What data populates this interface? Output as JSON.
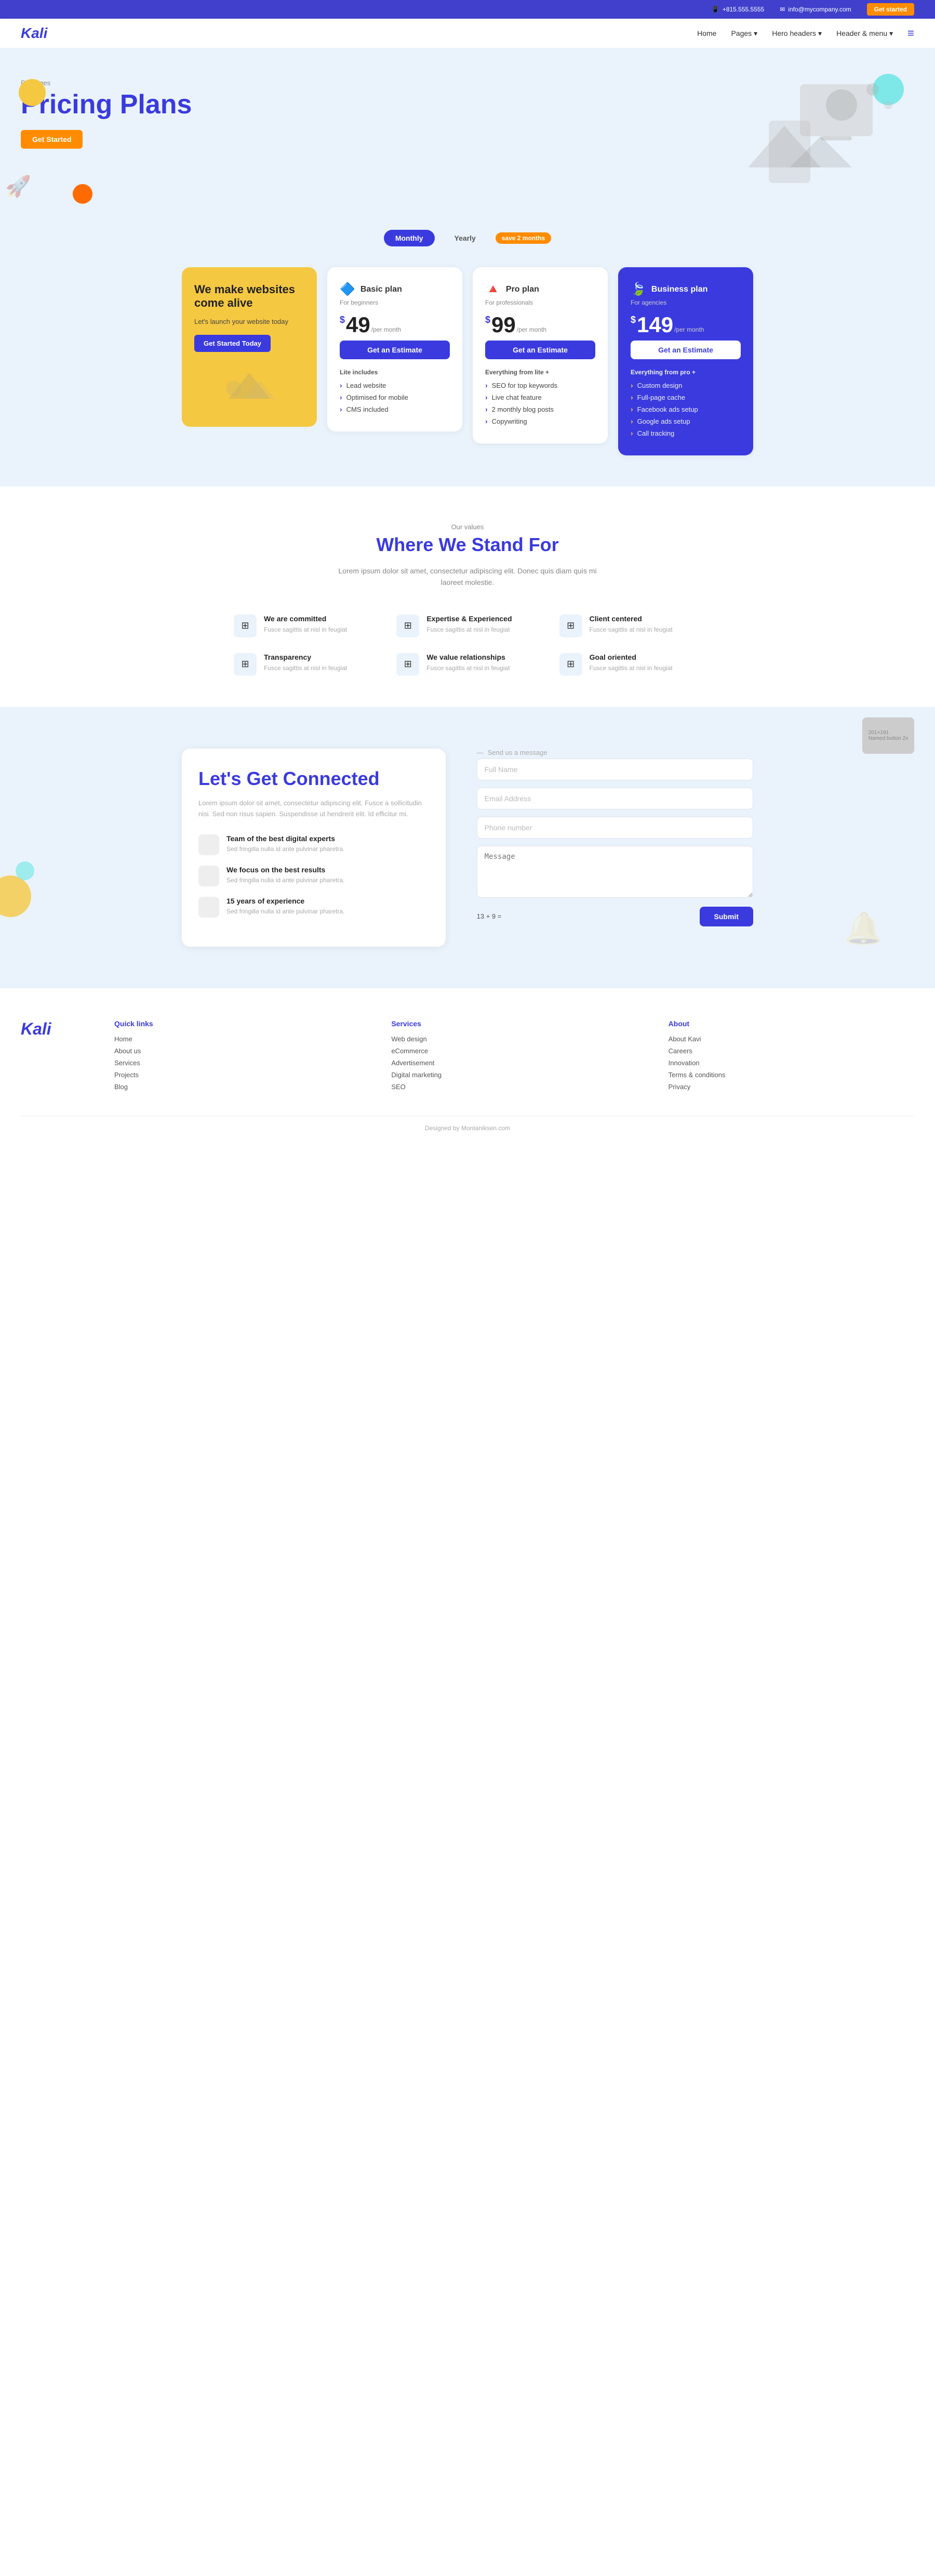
{
  "topbar": {
    "phone": "+815.555.5555",
    "email": "info@mycompany.com",
    "cta_label": "Get started",
    "phone_icon": "📱",
    "email_icon": "✉"
  },
  "navbar": {
    "logo": "Kali",
    "links": [
      {
        "label": "Home",
        "has_dropdown": false
      },
      {
        "label": "Pages",
        "has_dropdown": true
      },
      {
        "label": "Hero headers",
        "has_dropdown": true
      },
      {
        "label": "Header & menu",
        "has_dropdown": true
      }
    ],
    "hamburger_icon": "≡"
  },
  "hero": {
    "packages_label": "Packages",
    "title": "Pricing Plans",
    "btn_label": "Get Started"
  },
  "pricing_toggle": {
    "monthly_label": "Monthly",
    "yearly_label": "Yearly",
    "save_badge": "save 2 months"
  },
  "promo_card": {
    "title": "We make websites come alive",
    "subtitle": "Let's launch your website today",
    "btn_label": "Get Started Today"
  },
  "plans": [
    {
      "name": "Basic plan",
      "for": "For beginners",
      "price": "49",
      "period": "/per month",
      "btn_label": "Get an Estimate",
      "includes_label": "Lite includes",
      "features": [
        "Lead website",
        "Optimised for mobile",
        "CMS included"
      ],
      "featured": false
    },
    {
      "name": "Pro plan",
      "for": "For professionals",
      "price": "99",
      "period": "/per month",
      "btn_label": "Get an Estimate",
      "includes_label": "Everything from lite +",
      "features": [
        "SEO for top keywords",
        "Live chat feature",
        "2 monthly blog posts",
        "Copywriting"
      ],
      "featured": false
    },
    {
      "name": "Business plan",
      "for": "For agencies",
      "price": "149",
      "period": "/per month",
      "btn_label": "Get an Estimate",
      "includes_label": "Everything from pro +",
      "features": [
        "Custom design",
        "Full-page cache",
        "Facebook ads setup",
        "Google ads setup",
        "Call tracking"
      ],
      "featured": true
    }
  ],
  "values": {
    "section_label": "Our values",
    "title": "Where We Stand For",
    "description": "Lorem ipsum dolor sit amet, consectetur adipiscing elit. Donec quis diam quis mi laoreet molestie.",
    "items": [
      {
        "title": "We are committed",
        "desc": "Fusce sagittis at nisl in feugiat"
      },
      {
        "title": "Expertise & Experienced",
        "desc": "Fusce sagittis at nisl in feugiat"
      },
      {
        "title": "Client centered",
        "desc": "Fusce sagittis at nisl in feugiat"
      },
      {
        "title": "Transparency",
        "desc": "Fusce sagittis at nisl in feugiat"
      },
      {
        "title": "We value relationships",
        "desc": "Fusce sagittis at nisl in feugiat"
      },
      {
        "title": "Goal oriented",
        "desc": "Fusce sagittis at nisl in feugiat"
      }
    ]
  },
  "contact": {
    "title": "Let's Get Connected",
    "description": "Lorem ipsum dolor sit amet, consectetur adipiscing elit. Fusce a sollicitudin nisi. Sed non risus sapien. Suspendisse ut hendrerit elit. Id efficitur mi.",
    "features": [
      {
        "title": "Team of the best digital experts",
        "desc": "Sed fringilla nulla id ante pulvinar pharetra."
      },
      {
        "title": "We focus on the best results",
        "desc": "Sed fringilla nulla id ante pulvinar pharetra."
      },
      {
        "title": "15 years of experience",
        "desc": "Sed fringilla nulla id ante pulvinar pharetra."
      }
    ],
    "form": {
      "section_label": "Send us a message",
      "full_name_placeholder": "Full Name",
      "email_placeholder": "Email Address",
      "phone_placeholder": "Phone number",
      "message_placeholder": "Message",
      "captcha": "13 + 9 =",
      "submit_label": "Submit"
    }
  },
  "footer": {
    "logo": "Kali",
    "quick_links_title": "Quick links",
    "quick_links": [
      "Home",
      "About us",
      "Services",
      "Projects",
      "Blog"
    ],
    "services_title": "Services",
    "services": [
      "Web design",
      "eCommerce",
      "Advertisement",
      "Digital marketing",
      "SEO"
    ],
    "about_title": "About",
    "about_links": [
      "About Kavi",
      "Careers",
      "Innovation",
      "Terms & conditions",
      "Privacy"
    ],
    "bottom_text": "Designed by Montaniksen.com"
  }
}
